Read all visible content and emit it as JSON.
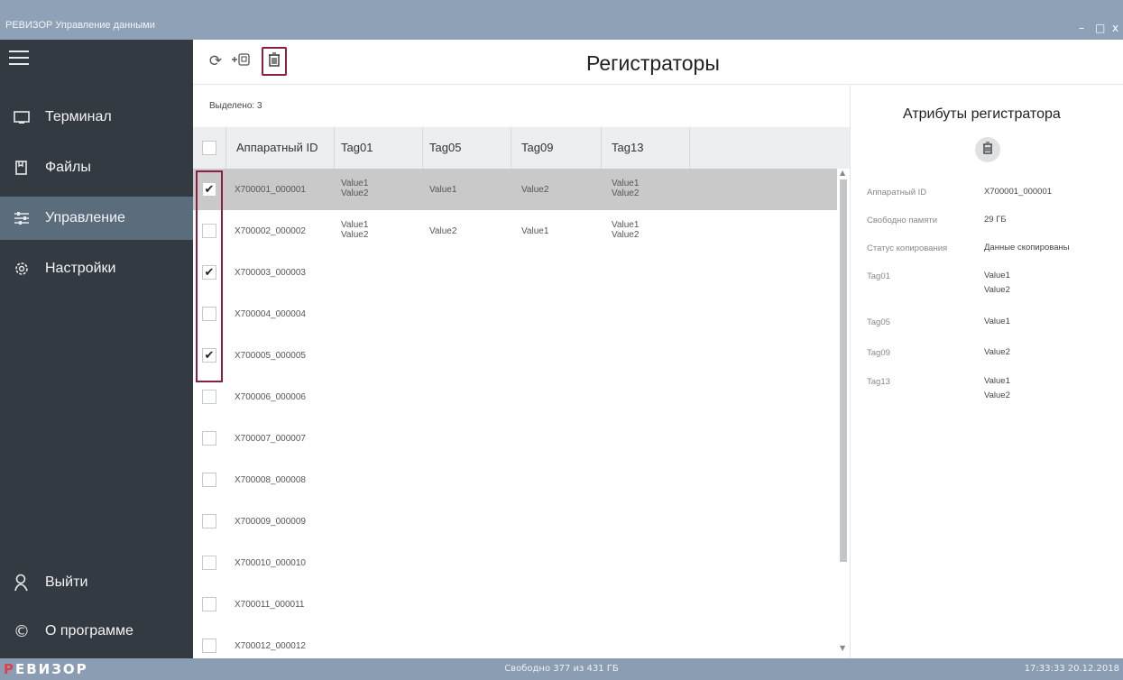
{
  "window": {
    "title": "РЕВИЗОР Управление данными",
    "minimize": "–",
    "maximize": "□",
    "close": "x"
  },
  "sidebar": {
    "items": [
      {
        "label": "Терминал",
        "icon": "terminal-icon"
      },
      {
        "label": "Файлы",
        "icon": "files-icon"
      },
      {
        "label": "Управление",
        "icon": "sliders-icon",
        "active": true
      },
      {
        "label": "Настройки",
        "icon": "gear-icon"
      }
    ],
    "bottom": [
      {
        "label": "Выйти",
        "icon": "user-icon"
      },
      {
        "label": "О программе",
        "icon": "copyright-icon"
      }
    ]
  },
  "toolbar": {
    "title": "Регистраторы",
    "refresh_icon": "refresh-icon",
    "add_icon": "add-device-icon",
    "delete_icon": "trash-icon"
  },
  "table": {
    "selected_label": "Выделено: 3",
    "columns": [
      "Аппаратный ID",
      "Tag01",
      "Tag05",
      "Tag09",
      "Tag13"
    ],
    "rows": [
      {
        "id": "X700001_000001",
        "checked": true,
        "tag01": "Value1\nValue2",
        "tag05": "Value1",
        "tag09": "Value2",
        "tag13": "Value1\nValue2",
        "selected": true
      },
      {
        "id": "X700002_000002",
        "checked": false,
        "tag01": "Value1\nValue2",
        "tag05": "Value2",
        "tag09": "Value1",
        "tag13": "Value1\nValue2"
      },
      {
        "id": "X700003_000003",
        "checked": true
      },
      {
        "id": "X700004_000004",
        "checked": false
      },
      {
        "id": "X700005_000005",
        "checked": true
      },
      {
        "id": "X700006_000006",
        "checked": false
      },
      {
        "id": "X700007_000007",
        "checked": false
      },
      {
        "id": "X700008_000008",
        "checked": false
      },
      {
        "id": "X700009_000009",
        "checked": false
      },
      {
        "id": "X700010_000010",
        "checked": false
      },
      {
        "id": "X700011_000011",
        "checked": false
      },
      {
        "id": "X700012_000012",
        "checked": false
      }
    ]
  },
  "attributes": {
    "title": "Атрибуты регистратора",
    "items": [
      {
        "key": "Аппаратный ID",
        "value": "X700001_000001"
      },
      {
        "key": "Свободно памяти",
        "value": "29 ГБ"
      },
      {
        "key": "Статус копирования",
        "value": "Данные скопированы"
      },
      {
        "key": "Tag01",
        "value": "Value1\nValue2"
      },
      {
        "key": "Tag05",
        "value": "Value1"
      },
      {
        "key": "Tag09",
        "value": "Value2"
      },
      {
        "key": "Tag13",
        "value": "Value1\nValue2"
      }
    ]
  },
  "status": {
    "logo": "ЕВИЗОР",
    "logo_first": "Р",
    "free": "Свободно 377 из 431 ГБ",
    "clock": "17:33:33 20.12.2018"
  },
  "colors": {
    "sidebar": "#343a41",
    "sidebar_active": "#5b6c7d",
    "accent_frame": "#8c1d45",
    "titlebar": "#8ea1b6",
    "statusbar": "#8a9db3"
  }
}
